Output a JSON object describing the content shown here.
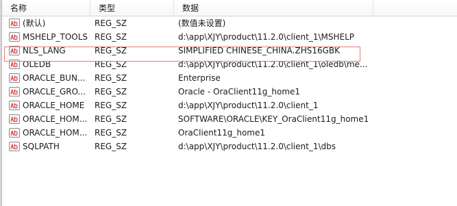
{
  "columns": {
    "name": "名称",
    "type": "类型",
    "data": "数据"
  },
  "rows": [
    {
      "name": "(默认)",
      "type": "REG_SZ",
      "data": "(数值未设置)"
    },
    {
      "name": "MSHELP_TOOLS",
      "type": "REG_SZ",
      "data": "d:\\app\\XJY\\product\\11.2.0\\client_1\\MSHELP"
    },
    {
      "name": "NLS_LANG",
      "type": "REG_SZ",
      "data": "SIMPLIFIED CHINESE_CHINA.ZHS16GBK"
    },
    {
      "name": "OLEDB",
      "type": "REG_SZ",
      "data": "d:\\app\\XJY\\product\\11.2.0\\client_1\\oledb\\me..."
    },
    {
      "name": "ORACLE_BUN...",
      "type": "REG_SZ",
      "data": "Enterprise"
    },
    {
      "name": "ORACLE_GRO...",
      "type": "REG_SZ",
      "data": "Oracle - OraClient11g_home1"
    },
    {
      "name": "ORACLE_HOME",
      "type": "REG_SZ",
      "data": "d:\\app\\XJY\\product\\11.2.0\\client_1"
    },
    {
      "name": "ORACLE_HOM...",
      "type": "REG_SZ",
      "data": "SOFTWARE\\ORACLE\\KEY_OraClient11g_home1"
    },
    {
      "name": "ORACLE_HOM...",
      "type": "REG_SZ",
      "data": "OraClient11g_home1"
    },
    {
      "name": "SQLPATH",
      "type": "REG_SZ",
      "data": "d:\\app\\XJY\\product\\11.2.0\\client_1\\dbs"
    }
  ],
  "icons": {
    "row_icon": "registry-string-value-icon"
  },
  "colors": {
    "highlight_border": "#e47a7a",
    "icon_text": "#d33b3b"
  }
}
